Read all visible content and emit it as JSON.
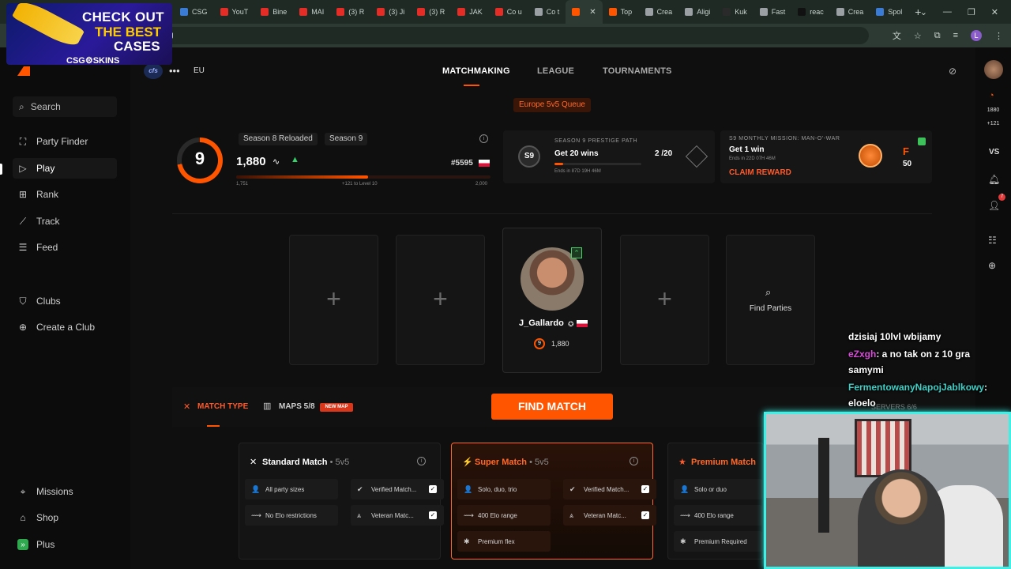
{
  "browser": {
    "tabs": [
      {
        "label": "CSG",
        "color": "#3a7bd5"
      },
      {
        "label": "YouT",
        "color": "#e52d27"
      },
      {
        "label": "Bine",
        "color": "#e52d27"
      },
      {
        "label": "MAI",
        "color": "#e52d27"
      },
      {
        "label": "(3) R",
        "color": "#e52d27"
      },
      {
        "label": "(3) Ji",
        "color": "#e52d27"
      },
      {
        "label": "(3) R",
        "color": "#e52d27"
      },
      {
        "label": "JAK",
        "color": "#e52d27"
      },
      {
        "label": "Co u",
        "color": "#e52d27"
      },
      {
        "label": "Co t",
        "color": "#9aa0a4"
      },
      {
        "label": "",
        "color": "#ff5500",
        "active": true
      },
      {
        "label": "Top",
        "color": "#ff5500"
      },
      {
        "label": "Crea",
        "color": "#9aa0a4"
      },
      {
        "label": "Aligi",
        "color": "#9aa0a4"
      },
      {
        "label": "Kuk",
        "color": "#2a2a2a"
      },
      {
        "label": "Fast",
        "color": "#9aa0a4"
      },
      {
        "label": "reac",
        "color": "#111111"
      },
      {
        "label": "Crea",
        "color": "#9aa0a4"
      },
      {
        "label": "Spol",
        "color": "#3a7bd5"
      }
    ],
    "omnibox_text": "g",
    "profile_initial": "L"
  },
  "ad": {
    "line1": "CHECK OUT",
    "line2": "THE BEST",
    "line3": "CASES",
    "brand": "CSG⚙SKINS"
  },
  "sidebar": {
    "search_placeholder": "Search",
    "items": [
      {
        "label": "Party Finder",
        "icon": "party-finder-icon",
        "glyph": "⛶"
      },
      {
        "label": "Play",
        "icon": "play-icon",
        "glyph": "▷",
        "active": true
      },
      {
        "label": "Rank",
        "icon": "rank-icon",
        "glyph": "⊞"
      },
      {
        "label": "Track",
        "icon": "track-icon",
        "glyph": "⟋"
      },
      {
        "label": "Feed",
        "icon": "feed-icon",
        "glyph": "☰"
      },
      {
        "label": "Clubs",
        "icon": "clubs-icon",
        "glyph": "⛉"
      },
      {
        "label": "Create a Club",
        "icon": "create-club-icon",
        "glyph": "⊕"
      }
    ],
    "bottom_items": [
      {
        "label": "Missions",
        "icon": "missions-icon",
        "glyph": "⌖"
      },
      {
        "label": "Shop",
        "icon": "shop-icon",
        "glyph": "⌂"
      },
      {
        "label": "Plus",
        "icon": "plus-icon",
        "glyph": "»"
      }
    ]
  },
  "header": {
    "club_tag": "cfs",
    "more": "•••",
    "region": "EU",
    "nav": [
      "MATCHMAKING",
      "LEAGUE",
      "TOURNAMENTS"
    ],
    "queue": "Europe 5v5 Queue"
  },
  "level": {
    "number": "9",
    "seasons": [
      "Season 8 Reloaded",
      "Season 9"
    ],
    "elo": "1,880",
    "rank": "#5595",
    "progress_fraction": 0.52,
    "min": "1,751",
    "to_next": "+121 to Level 10",
    "max": "2,000"
  },
  "prestige": {
    "badge": "S9",
    "eyebrow": "SEASON 9 PRESTIGE PATH",
    "goal": "Get 20 wins",
    "progress": "2 /20",
    "progress_fraction": 0.1,
    "ends": "Ends in 87D 19H 46M"
  },
  "mission": {
    "eyebrow": "S9 MONTHLY MISSION: MAN-O'-WAR",
    "goal": "Get 1 win",
    "ends": "Ends in 22D 07H 46M",
    "claim": "CLAIM REWARD",
    "points_label": "F",
    "points": "50"
  },
  "party": {
    "player_name": "J_Gallardo",
    "player_level": "9",
    "player_elo": "1,880",
    "find_parties": "Find Parties",
    "plus": "+"
  },
  "bottom": {
    "match_type": "MATCH TYPE",
    "maps": "MAPS 5/8",
    "new_map": "NEW MAP",
    "find_match": "FIND MATCH",
    "servers": "SERVERS 6/6"
  },
  "matches": [
    {
      "title": "Standard Match",
      "sub": " • 5v5",
      "opts": [
        {
          "label": "All party sizes",
          "glyph": "👤"
        },
        {
          "label": "Verified Match...",
          "glyph": "✔",
          "checked": true
        },
        {
          "label": "No Elo restrictions",
          "glyph": "⟿"
        },
        {
          "label": "Veteran Matc...",
          "glyph": "⩓",
          "checked": true
        }
      ]
    },
    {
      "title": "Super Match",
      "sub": " • 5v5",
      "opts": [
        {
          "label": "Solo, duo, trio",
          "glyph": "👤"
        },
        {
          "label": "Verified Match...",
          "glyph": "✔",
          "checked": true
        },
        {
          "label": "400 Elo range",
          "glyph": "⟿"
        },
        {
          "label": "Veteran Matc...",
          "glyph": "⩓",
          "checked": true
        },
        {
          "label": "Premium flex",
          "glyph": "✱"
        }
      ]
    },
    {
      "title": "Premium Match",
      "sub": "",
      "opts": [
        {
          "label": "Solo or duo",
          "glyph": "👤"
        },
        {
          "label": "400 Elo range",
          "glyph": "⟿"
        },
        {
          "label": "Premium Required",
          "glyph": "✱"
        }
      ]
    }
  ],
  "rail": {
    "elo": "1880",
    "delta": "+121",
    "vs": "VS",
    "notif_count": "7"
  },
  "chat": [
    {
      "user": "",
      "text": "dzisiaj 10lvl wbijamy"
    },
    {
      "user": "eZxgh",
      "text": ": a no tak on z 10 gra"
    },
    {
      "user": "",
      "text": "samymi"
    },
    {
      "user": "FermentowanyNapojJablkowy",
      "text": ":"
    },
    {
      "user": "",
      "text": "eloelo"
    }
  ]
}
